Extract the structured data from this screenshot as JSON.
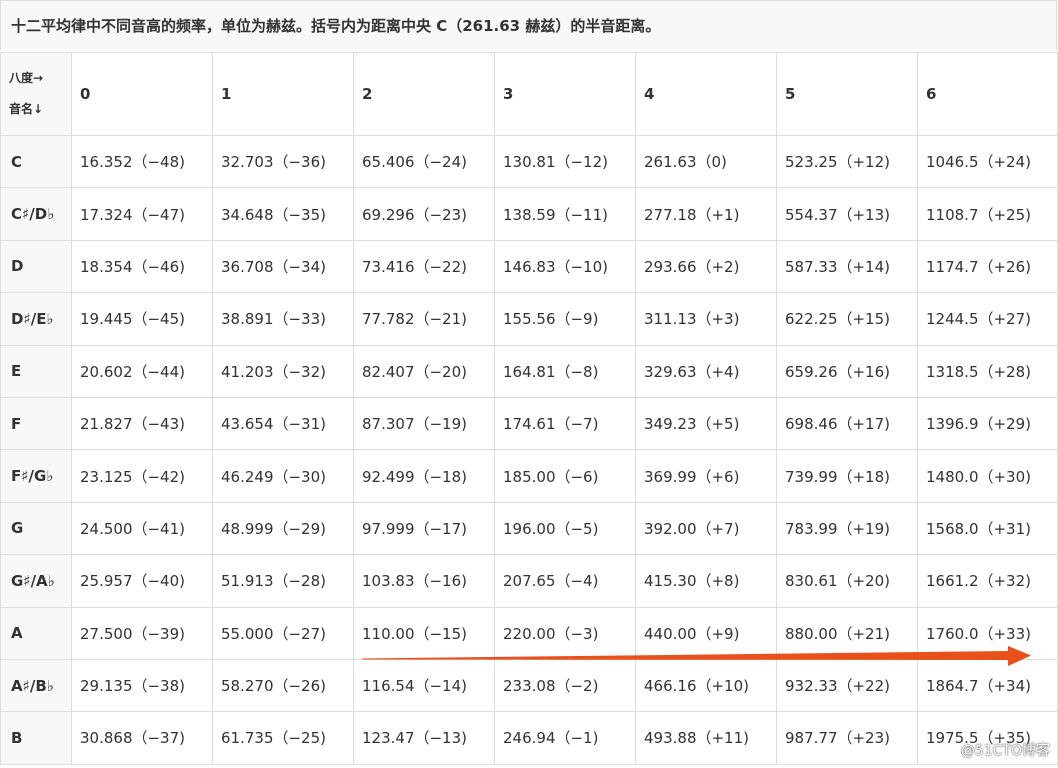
{
  "caption": "十二平均律中不同音高的频率，单位为赫兹。括号内为距离中央 C（261.63 赫兹）的半音距离。",
  "header": {
    "corner_top": "八度→",
    "corner_bottom": "音名↓",
    "octaves": [
      "0",
      "1",
      "2",
      "3",
      "4",
      "5",
      "6"
    ]
  },
  "rows": [
    {
      "note": "C",
      "cells": [
        "16.352（−48)",
        "32.703（−36)",
        "65.406（−24)",
        "130.81（−12)",
        "261.63（0)",
        "523.25（+12)",
        "1046.5（+24)"
      ]
    },
    {
      "note": "C♯/D♭",
      "cells": [
        "17.324（−47)",
        "34.648（−35)",
        "69.296（−23)",
        "138.59（−11)",
        "277.18（+1)",
        "554.37（+13)",
        "1108.7（+25)"
      ]
    },
    {
      "note": "D",
      "cells": [
        "18.354（−46)",
        "36.708（−34)",
        "73.416（−22)",
        "146.83（−10)",
        "293.66（+2)",
        "587.33（+14)",
        "1174.7（+26)"
      ]
    },
    {
      "note": "D♯/E♭",
      "cells": [
        "19.445（−45)",
        "38.891（−33)",
        "77.782（−21)",
        "155.56（−9)",
        "311.13（+3)",
        "622.25（+15)",
        "1244.5（+27)"
      ]
    },
    {
      "note": "E",
      "cells": [
        "20.602（−44)",
        "41.203（−32)",
        "82.407（−20)",
        "164.81（−8)",
        "329.63（+4)",
        "659.26（+16)",
        "1318.5（+28)"
      ]
    },
    {
      "note": "F",
      "cells": [
        "21.827（−43)",
        "43.654（−31)",
        "87.307（−19)",
        "174.61（−7)",
        "349.23（+5)",
        "698.46（+17)",
        "1396.9（+29)"
      ]
    },
    {
      "note": "F♯/G♭",
      "cells": [
        "23.125（−42)",
        "46.249（−30)",
        "92.499（−18)",
        "185.00（−6)",
        "369.99（+6)",
        "739.99（+18)",
        "1480.0（+30)"
      ]
    },
    {
      "note": "G",
      "cells": [
        "24.500（−41)",
        "48.999（−29)",
        "97.999（−17)",
        "196.00（−5)",
        "392.00（+7)",
        "783.99（+19)",
        "1568.0（+31)"
      ]
    },
    {
      "note": "G♯/A♭",
      "cells": [
        "25.957（−40)",
        "51.913（−28)",
        "103.83（−16)",
        "207.65（−4)",
        "415.30（+8)",
        "830.61（+20)",
        "1661.2（+32)"
      ]
    },
    {
      "note": "A",
      "cells": [
        "27.500（−39)",
        "55.000（−27)",
        "110.00（−15)",
        "220.00（−3)",
        "440.00（+9)",
        "880.00（+21)",
        "1760.0（+33)"
      ]
    },
    {
      "note": "A♯/B♭",
      "cells": [
        "29.135（−38)",
        "58.270（−26)",
        "116.54（−14)",
        "233.08（−2)",
        "466.16（+10)",
        "932.33（+22)",
        "1864.7（+34)"
      ]
    },
    {
      "note": "B",
      "cells": [
        "30.868（−37)",
        "61.735（−25)",
        "123.47（−13)",
        "246.94（−1)",
        "493.88（+11)",
        "987.77（+23)",
        "1975.5（+35)"
      ]
    }
  ],
  "annotation": {
    "arrow_color": "#e8501c"
  },
  "watermark": "@51CTO博客",
  "colors": {
    "border": "#dddddd",
    "header_bg": "#f8f8f8",
    "text": "#333333"
  }
}
